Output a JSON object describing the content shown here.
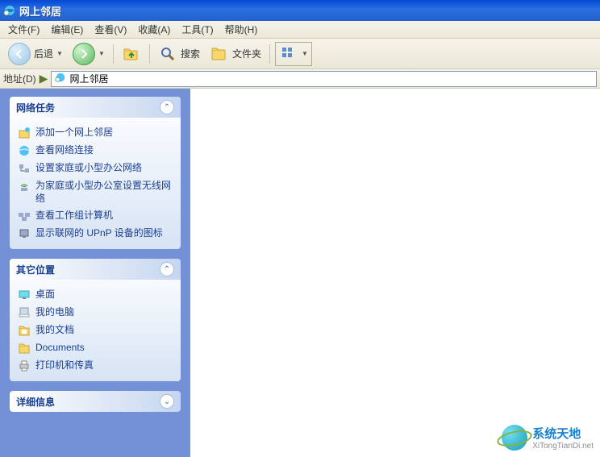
{
  "window": {
    "title": "网上邻居"
  },
  "menu": {
    "file": "文件(F)",
    "edit": "编辑(E)",
    "view": "查看(V)",
    "favorites": "收藏(A)",
    "tools": "工具(T)",
    "help": "帮助(H)"
  },
  "toolbar": {
    "back": "后退",
    "search": "搜索",
    "folders": "文件夹"
  },
  "address": {
    "label": "地址(D)",
    "value": "网上邻居"
  },
  "panels": {
    "network_tasks": {
      "title": "网络任务",
      "items": [
        "添加一个网上邻居",
        "查看网络连接",
        "设置家庭或小型办公网络",
        "为家庭或小型办公室设置无线网络",
        "查看工作组计算机",
        "显示联网的 UPnP 设备的图标"
      ]
    },
    "other_places": {
      "title": "其它位置",
      "items": [
        "桌面",
        "我的电脑",
        "我的文档",
        "Documents",
        "打印机和传真"
      ]
    },
    "details": {
      "title": "详细信息"
    }
  },
  "watermark": {
    "main": "系统天地",
    "sub": "XiTongTianDi.net"
  }
}
